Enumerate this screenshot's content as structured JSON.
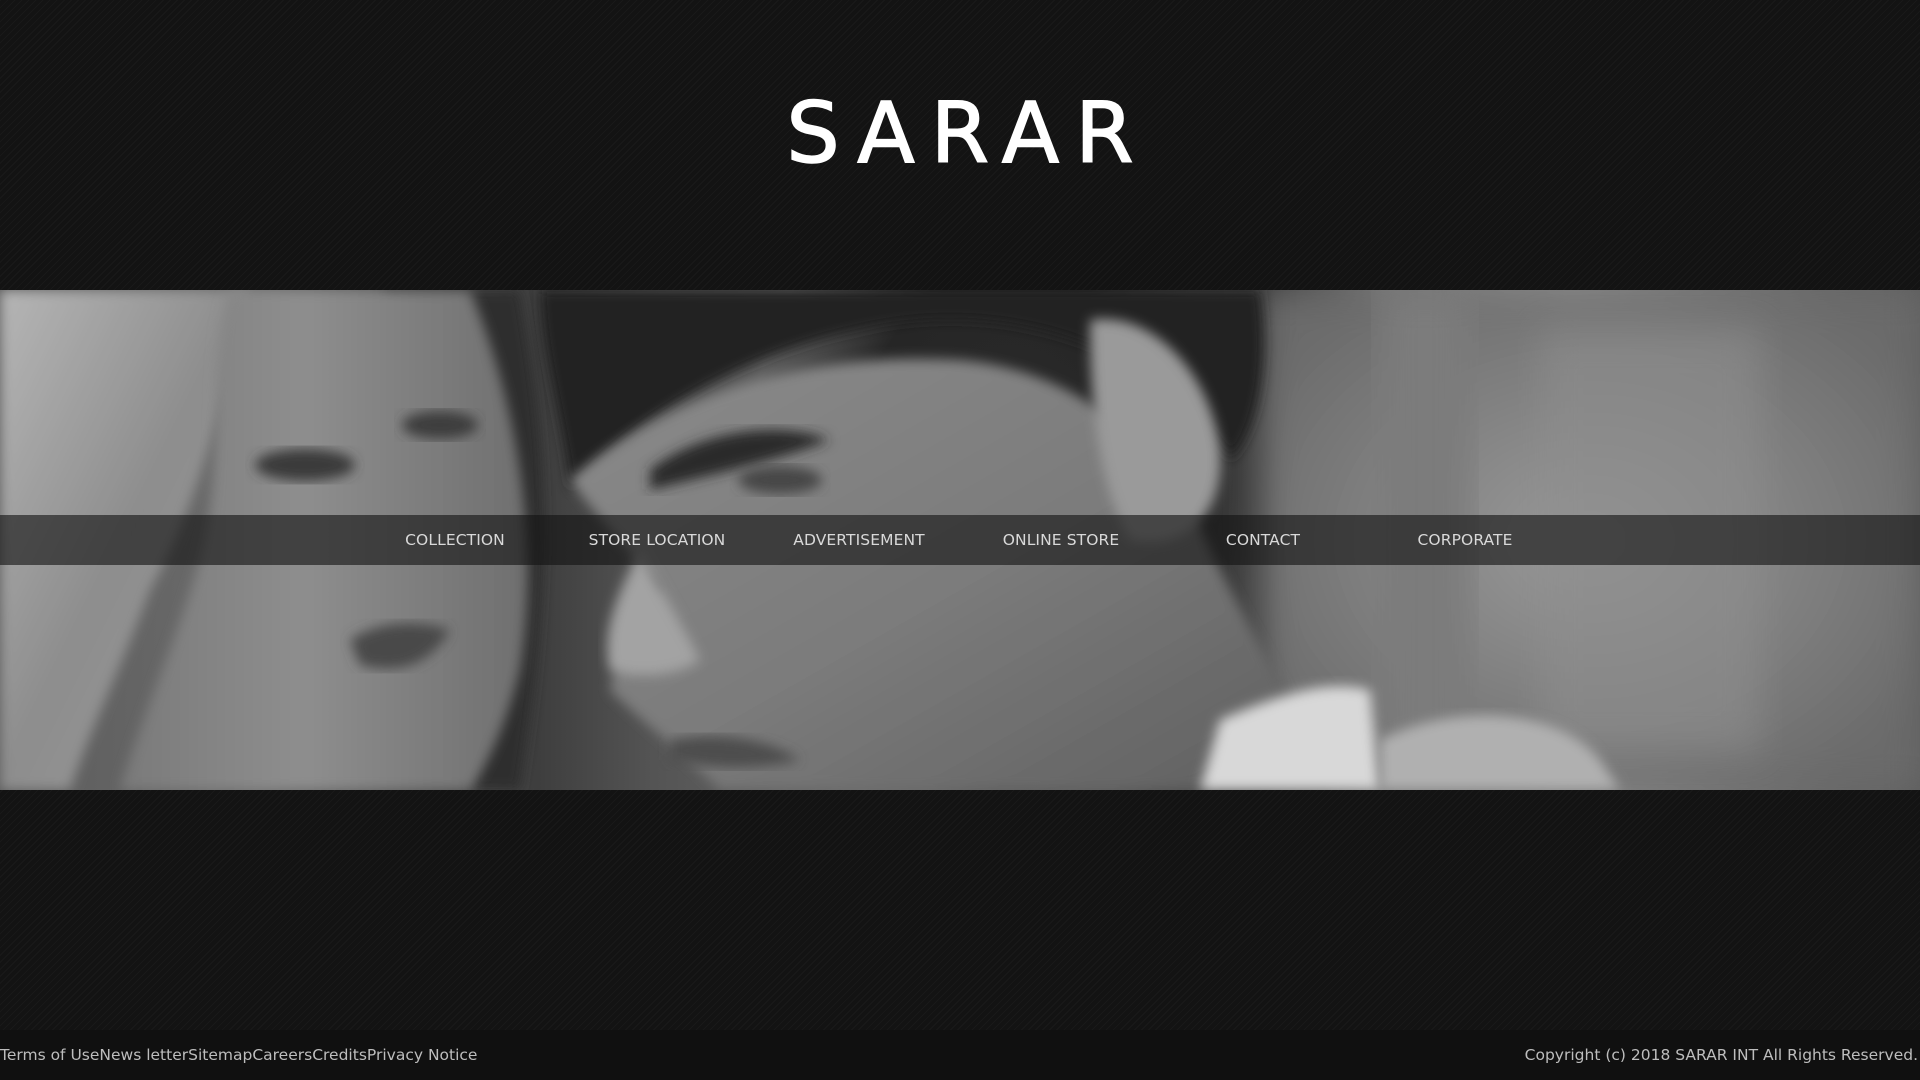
{
  "brand": {
    "logo_text": "SARAR"
  },
  "hero": {
    "image_description": "black-and-white-portrait-woman-and-man"
  },
  "nav": {
    "items": [
      {
        "label": "COLLECTION"
      },
      {
        "label": "STORE LOCATION"
      },
      {
        "label": "ADVERTISEMENT"
      },
      {
        "label": "ONLINE STORE"
      },
      {
        "label": "CONTACT"
      },
      {
        "label": "CORPORATE"
      }
    ]
  },
  "footer": {
    "links": [
      {
        "label": "Terms of Use"
      },
      {
        "label": "News letter"
      },
      {
        "label": "Sitemap"
      },
      {
        "label": "Careers"
      },
      {
        "label": "Credits"
      },
      {
        "label": "Privacy Notice"
      }
    ],
    "copyright": "Copyright (c) 2018 SARAR INT All Rights Reserved."
  },
  "colors": {
    "page_background": "#131313",
    "logo": "#ffffff",
    "nav_text": "#d9d9d9",
    "footer_text": "#bdbdbd"
  }
}
